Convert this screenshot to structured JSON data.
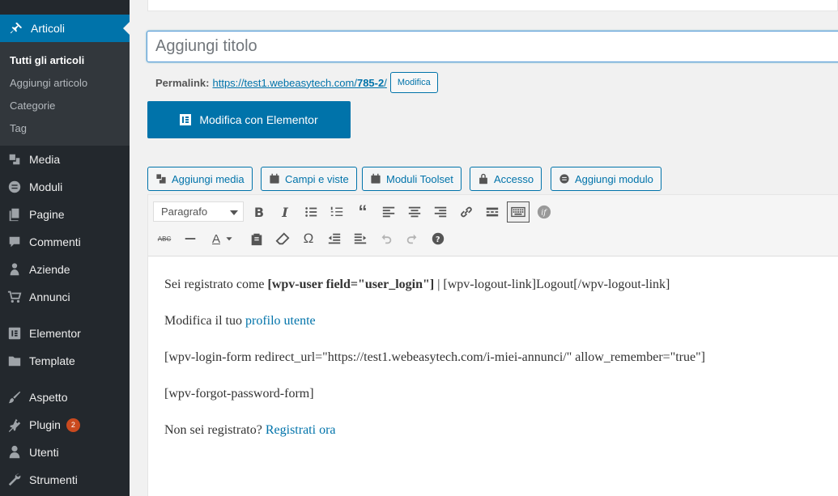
{
  "sidebar": {
    "active": {
      "label": "Articoli",
      "icon": "pin-icon"
    },
    "submenu": [
      "Tutti gli articoli",
      "Aggiungi articolo",
      "Categorie",
      "Tag"
    ],
    "items": [
      {
        "label": "Media",
        "icon": "media-icon"
      },
      {
        "label": "Moduli",
        "icon": "forms-icon"
      },
      {
        "label": "Pagine",
        "icon": "pages-icon"
      },
      {
        "label": "Commenti",
        "icon": "comments-icon"
      },
      {
        "label": "Aziende",
        "icon": "users-icon"
      },
      {
        "label": "Annunci",
        "icon": "cart-icon"
      },
      {
        "label": "Elementor",
        "icon": "elementor-icon"
      },
      {
        "label": "Template",
        "icon": "folder-icon"
      },
      {
        "label": "Aspetto",
        "icon": "brush-icon"
      },
      {
        "label": "Plugin",
        "icon": "plugin-icon",
        "badge": "2"
      },
      {
        "label": "Utenti",
        "icon": "user-icon"
      },
      {
        "label": "Strumenti",
        "icon": "wrench-icon"
      }
    ]
  },
  "editor": {
    "title_placeholder": "Aggiungi titolo",
    "permalink_label": "Permalink:",
    "permalink_base": "https://test1.webeasytech.com/",
    "permalink_slug": "785-2",
    "permalink_suffix": "/",
    "edit_permalink": "Modifica",
    "elementor_button": "Modifica con Elementor",
    "media_buttons": [
      "Aggiungi media",
      "Campi e viste",
      "Moduli Toolset",
      "Accesso",
      "Aggiungi modulo"
    ],
    "format_select": "Paragrafo",
    "content": {
      "p1_a": "Sei registrato come ",
      "p1_bold": "[wpv-user field=\"user_login\"]",
      "p1_b": " | [wpv-logout-link]Logout[/wpv-logout-link]",
      "p2_a": "Modifica il tuo ",
      "p2_link": "profilo utente",
      "p3": "[wpv-login-form redirect_url=\"https://test1.webeasytech.com/i-miei-annunci/\" allow_remember=\"true\"]",
      "p4": "[wpv-forgot-password-form]",
      "p5_a": "Non sei registrato? ",
      "p5_link": "Registrati ora"
    }
  },
  "colors": {
    "accent": "#0073aa",
    "sidebar_bg": "#23282d",
    "badge": "#ca4a1f"
  }
}
